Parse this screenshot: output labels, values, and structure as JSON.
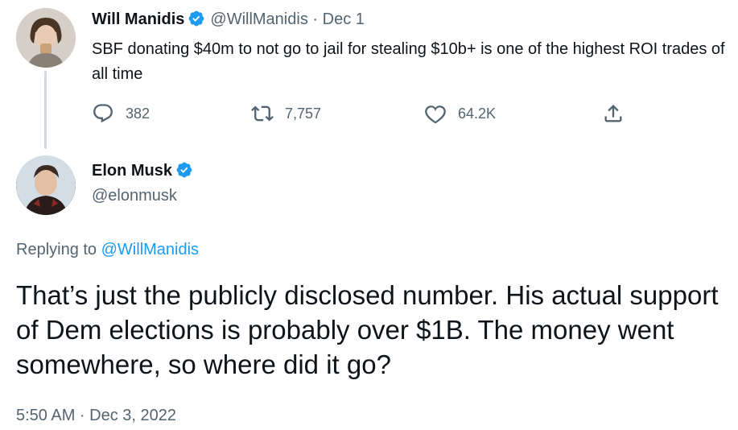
{
  "parent_tweet": {
    "author_name": "Will Manidis",
    "handle": "@WillManidis",
    "separator": "·",
    "date": "Dec 1",
    "text": "SBF donating $40m to not go to jail for stealing $10b+ is one of the highest ROI trades of all time",
    "actions": {
      "replies": "382",
      "retweets": "7,757",
      "likes": "64.2K"
    },
    "icons": [
      "reply-icon",
      "retweet-icon",
      "like-icon",
      "share-icon",
      "verified-icon"
    ]
  },
  "main_tweet": {
    "author_name": "Elon Musk",
    "handle": "@elonmusk",
    "replying_prefix": "Replying to",
    "replying_to": "@WillManidis",
    "text": "That’s just the publicly disclosed number. His actual support of Dem elections is probably over $1B. The money went somewhere, so where did it go?",
    "timestamp": "5:50 AM · Dec 3, 2022"
  },
  "colors": {
    "text_primary": "#0f1419",
    "text_muted": "#536471",
    "link": "#1d9bf0",
    "verified": "#1d9bf0",
    "thread_line": "#cfd9de"
  }
}
